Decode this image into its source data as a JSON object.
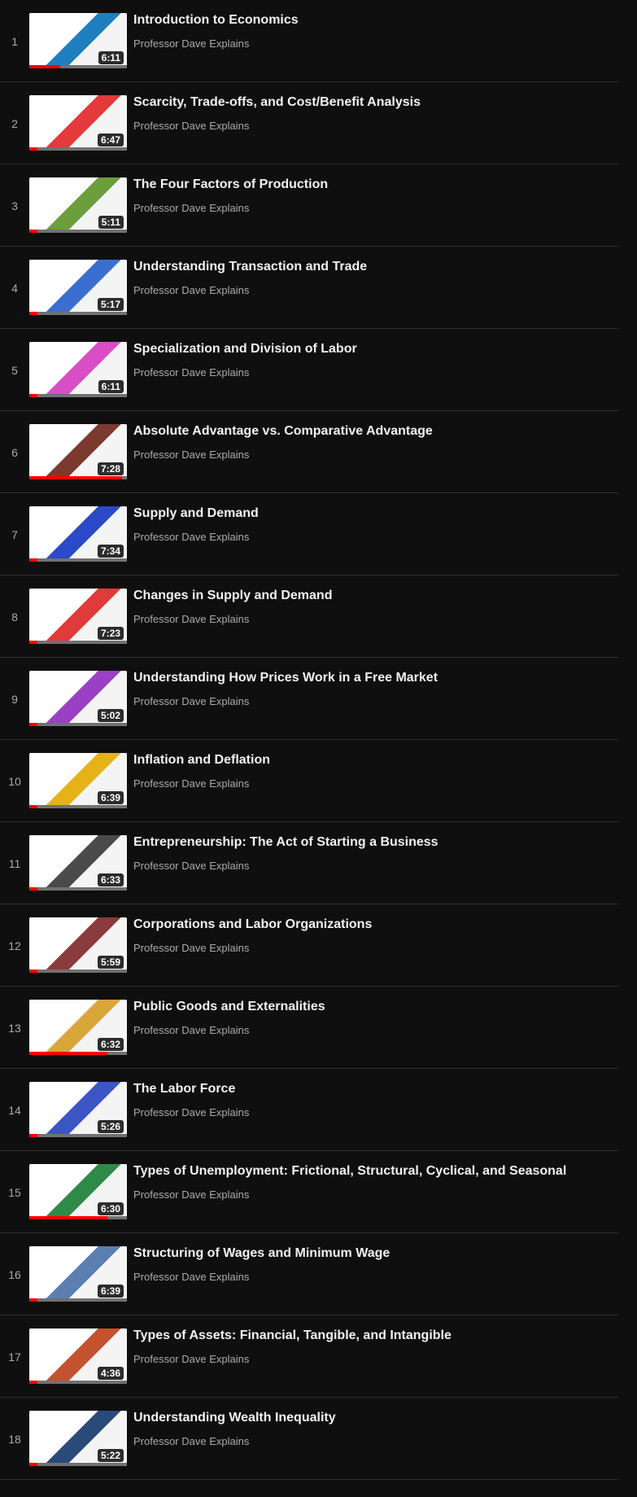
{
  "playlist": {
    "items": [
      {
        "index": "1",
        "title": "Introduction to Economics",
        "channel": "Professor Dave Explains",
        "duration": "6:11",
        "progress": 0.32,
        "theme": "#1f7fbf"
      },
      {
        "index": "2",
        "title": "Scarcity, Trade-offs, and Cost/Benefit Analysis",
        "channel": "Professor Dave Explains",
        "duration": "6:47",
        "progress": 0.08,
        "theme": "#e5393b"
      },
      {
        "index": "3",
        "title": "The Four Factors of Production",
        "channel": "Professor Dave Explains",
        "duration": "5:11",
        "progress": 0.08,
        "theme": "#6a9f3c"
      },
      {
        "index": "4",
        "title": "Understanding Transaction and Trade",
        "channel": "Professor Dave Explains",
        "duration": "5:17",
        "progress": 0.08,
        "theme": "#3a6fd0"
      },
      {
        "index": "5",
        "title": "Specialization and Division of Labor",
        "channel": "Professor Dave Explains",
        "duration": "6:11",
        "progress": 0.08,
        "theme": "#d94dc7"
      },
      {
        "index": "6",
        "title": "Absolute Advantage vs. Comparative Advantage",
        "channel": "Professor Dave Explains",
        "duration": "7:28",
        "progress": 0.95,
        "theme": "#7a3b2e"
      },
      {
        "index": "7",
        "title": "Supply and Demand",
        "channel": "Professor Dave Explains",
        "duration": "7:34",
        "progress": 0.08,
        "theme": "#2b49c9"
      },
      {
        "index": "8",
        "title": "Changes in Supply and Demand",
        "channel": "Professor Dave Explains",
        "duration": "7:23",
        "progress": 0.08,
        "theme": "#e03a3a"
      },
      {
        "index": "9",
        "title": "Understanding How Prices Work in a Free Market",
        "channel": "Professor Dave Explains",
        "duration": "5:02",
        "progress": 0.08,
        "theme": "#9b3fc4"
      },
      {
        "index": "10",
        "title": "Inflation and Deflation",
        "channel": "Professor Dave Explains",
        "duration": "6:39",
        "progress": 0.08,
        "theme": "#e6b21a"
      },
      {
        "index": "11",
        "title": "Entrepreneurship: The Act of Starting a Business",
        "channel": "Professor Dave Explains",
        "duration": "6:33",
        "progress": 0.08,
        "theme": "#4a4a4a"
      },
      {
        "index": "12",
        "title": "Corporations and Labor Organizations",
        "channel": "Professor Dave Explains",
        "duration": "5:59",
        "progress": 0.08,
        "theme": "#8a3b3b"
      },
      {
        "index": "13",
        "title": "Public Goods and Externalities",
        "channel": "Professor Dave Explains",
        "duration": "6:32",
        "progress": 0.8,
        "theme": "#d9a63a"
      },
      {
        "index": "14",
        "title": "The Labor Force",
        "channel": "Professor Dave Explains",
        "duration": "5:26",
        "progress": 0.08,
        "theme": "#3a56c4"
      },
      {
        "index": "15",
        "title": "Types of Unemployment: Frictional, Structural, Cyclical, and Seasonal",
        "channel": "Professor Dave Explains",
        "duration": "6:30",
        "progress": 0.8,
        "theme": "#2f8a4a"
      },
      {
        "index": "16",
        "title": "Structuring of Wages and Minimum Wage",
        "channel": "Professor Dave Explains",
        "duration": "6:39",
        "progress": 0.08,
        "theme": "#5a7fb0"
      },
      {
        "index": "17",
        "title": "Types of Assets: Financial, Tangible, and Intangible",
        "channel": "Professor Dave Explains",
        "duration": "4:36",
        "progress": 0.08,
        "theme": "#c4522f"
      },
      {
        "index": "18",
        "title": "Understanding Wealth Inequality",
        "channel": "Professor Dave Explains",
        "duration": "5:22",
        "progress": 0.08,
        "theme": "#2a4a7a"
      }
    ]
  }
}
